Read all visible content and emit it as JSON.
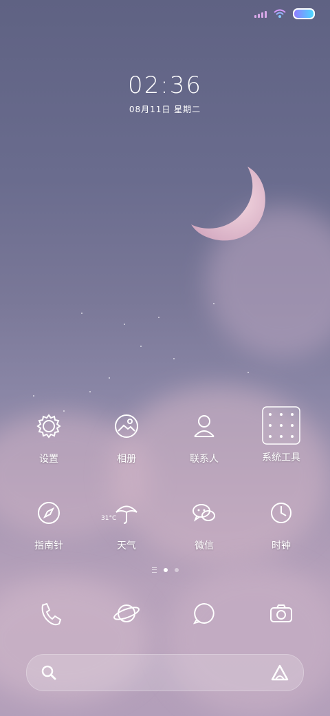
{
  "status_bar": {
    "signal_icon": "signal-bars-icon",
    "wifi_icon": "wifi-icon",
    "battery_icon": "battery-icon"
  },
  "lock": {
    "time": "02:36",
    "date": "08月11日  星期二"
  },
  "apps": [
    {
      "label": "设置",
      "icon": "settings-gear-icon"
    },
    {
      "label": "相册",
      "icon": "gallery-icon"
    },
    {
      "label": "联系人",
      "icon": "contacts-icon"
    },
    {
      "label": "系统工具",
      "icon": "system-tools-folder-icon"
    },
    {
      "label": "指南针",
      "icon": "compass-icon"
    },
    {
      "label": "天气",
      "icon": "weather-umbrella-icon",
      "temp": "31°C"
    },
    {
      "label": "微信",
      "icon": "wechat-icon"
    },
    {
      "label": "时钟",
      "icon": "clock-icon"
    }
  ],
  "page_indicator": {
    "total": 2,
    "active": 1
  },
  "dock": [
    {
      "icon": "phone-icon"
    },
    {
      "icon": "browser-planet-icon"
    },
    {
      "icon": "messages-icon"
    },
    {
      "icon": "camera-icon"
    }
  ],
  "search": {
    "left_icon": "search-icon",
    "right_icon": "assistant-icon"
  },
  "colors": {
    "bg_top": "#5f6283",
    "bg_bottom": "#b39fba",
    "moon": "#e7c3cf",
    "accent": "#ffffff"
  }
}
